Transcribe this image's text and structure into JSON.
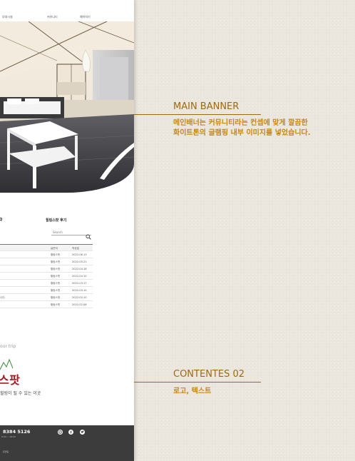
{
  "site": {
    "nav": [
      "부대시설",
      "커뮤니티",
      "예약하기"
    ],
    "tabs": [
      "Q",
      "힐링스팟 후기"
    ],
    "search_placeholder": "Search",
    "board": {
      "headers": [
        "",
        "글쓴이",
        "작성일"
      ],
      "rows": [
        {
          "title": "",
          "author": "힐링스팟",
          "date": "2022.06.13"
        },
        {
          "title": "",
          "author": "힐링스팟",
          "date": "2022.05.21"
        },
        {
          "title": "",
          "author": "힐링스팟",
          "date": "2022.04.18"
        },
        {
          "title": "",
          "author": "힐링스팟",
          "date": "2022.04.10"
        },
        {
          "title": "",
          "author": "힐링스팟",
          "date": "2022.03.17"
        },
        {
          "title": "",
          "author": "힐링스팟",
          "date": "2022.03.10"
        },
        {
          "title": "니다.",
          "author": "힐링스팟",
          "date": "2022.02.10"
        },
        {
          "title": "",
          "author": "힐링스팟",
          "date": "2022.02.08"
        }
      ]
    },
    "tagline": "our trip",
    "brand": "스팟",
    "description": "힐링이 될 수 있는 이곳",
    "footer": {
      "phone": "8384 5126",
      "hours": "0:00 ~ 18:00",
      "copyright": "· 운영팀"
    }
  },
  "annotations": [
    {
      "title": "MAIN BANNER",
      "body": "메인배너는 커뮤니티라는 컨셉에 맞게 깔끔한 화이트톤의 글램핑 내부 이미지를 넣었습니다."
    },
    {
      "title": "CONTENTES 02",
      "body": "로고, 텍스트"
    }
  ],
  "colors": {
    "accent": "#9a6a12",
    "annotation_text": "#c8870f",
    "brand_red": "#a01e25",
    "footer_bg": "#3c3c3c",
    "page_bg": "#ece7de"
  }
}
